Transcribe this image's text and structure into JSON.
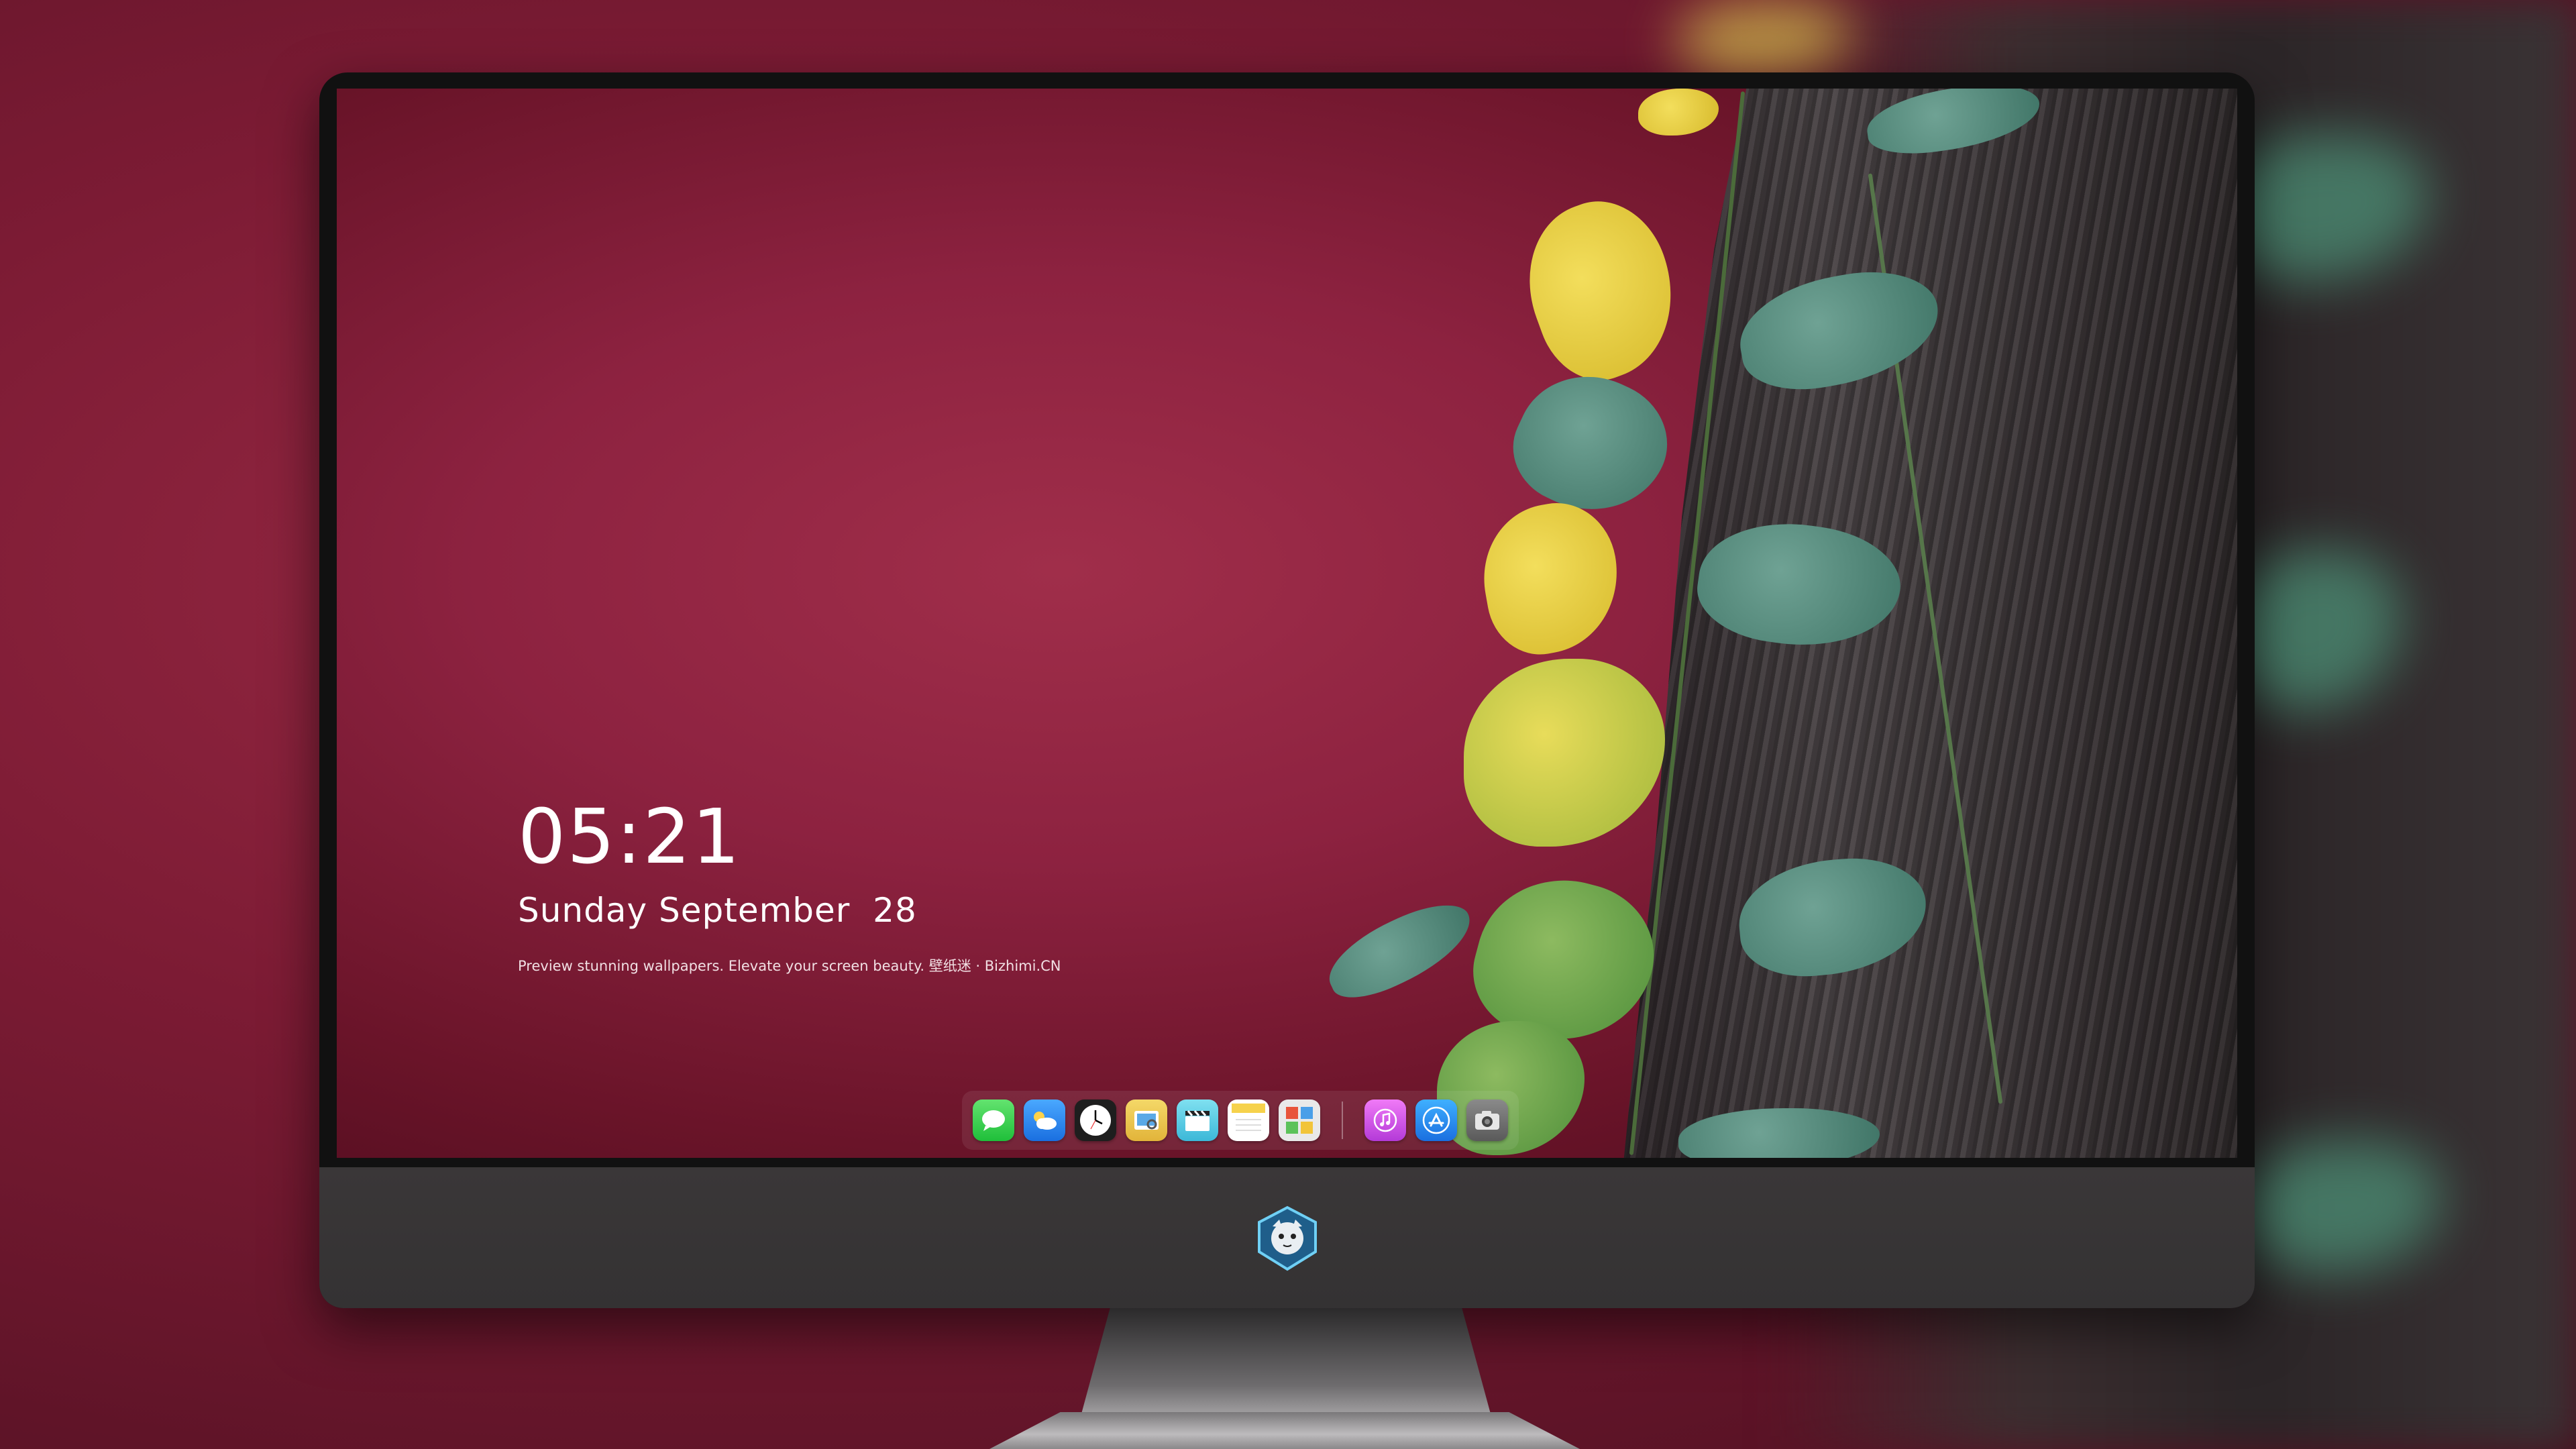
{
  "lockscreen": {
    "time": "05:21",
    "date": "Sunday September  28",
    "tagline": "Preview stunning wallpapers. Elevate your screen beauty. 壁纸迷 · Bizhimi.CN"
  },
  "dock": {
    "apps": [
      {
        "name": "messages",
        "icon": "message-bubble-icon",
        "color": "#2ecb4b"
      },
      {
        "name": "weather",
        "icon": "cloud-icon",
        "color": "#3a8ef0"
      },
      {
        "name": "clock",
        "icon": "clock-icon",
        "color": "#1e1e1e"
      },
      {
        "name": "preview",
        "icon": "preview-icon",
        "color": "#e9c64a"
      },
      {
        "name": "clips",
        "icon": "clapperboard-icon",
        "color": "#5fd0e6"
      },
      {
        "name": "notes",
        "icon": "notes-icon",
        "color": "#f6d24c"
      },
      {
        "name": "photo-booth",
        "icon": "photo-booth-icon",
        "color": "#e0e0e0"
      },
      {
        "name": "music",
        "icon": "music-note-icon",
        "color": "#d94fe6"
      },
      {
        "name": "app-store",
        "icon": "app-store-icon",
        "color": "#2d8ef5"
      },
      {
        "name": "screenshot",
        "icon": "camera-icon",
        "color": "#6a6a6a"
      }
    ]
  },
  "colors": {
    "wallpaper": "#8d2240",
    "background": "#7c1b34",
    "bezel": "#111111",
    "chin": "#3a3738"
  }
}
